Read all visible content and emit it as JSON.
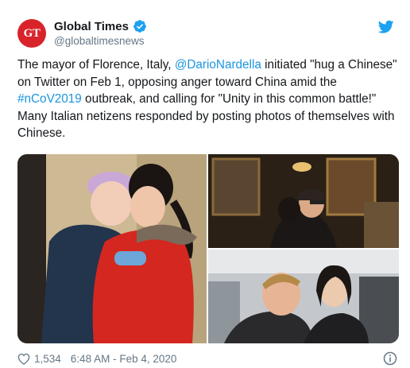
{
  "author": {
    "avatar_text": "GT",
    "display_name": "Global Times",
    "handle": "@globaltimesnews",
    "verified": true,
    "brand_color": "#d8232a"
  },
  "tweet": {
    "text_1": "The mayor of Florence, Italy, ",
    "mention": "@DarioNardella",
    "text_2": " initiated \"hug a Chinese\" on Twitter on Feb 1, opposing anger toward China amid the ",
    "hashtag": "#nCoV2019",
    "text_3": " outbreak, and calling for \"Unity in this common battle!\" Many Italian netizens responded by posting photos of themselves with Chinese."
  },
  "media": {
    "photos": [
      {
        "name": "two-girls-hugging"
      },
      {
        "name": "men-hugging-in-ornate-room"
      },
      {
        "name": "man-and-woman-hugging-selfie"
      }
    ]
  },
  "footer": {
    "likes": "1,534",
    "timestamp": "6:48 AM - Feb 4, 2020"
  },
  "colors": {
    "link": "#1b95e0",
    "secondary_text": "#657786",
    "twitter_blue": "#1da1f2"
  },
  "icons": {
    "verified": "verified-badge-icon",
    "platform": "twitter-bird-icon",
    "like": "heart-icon",
    "info": "info-icon"
  }
}
